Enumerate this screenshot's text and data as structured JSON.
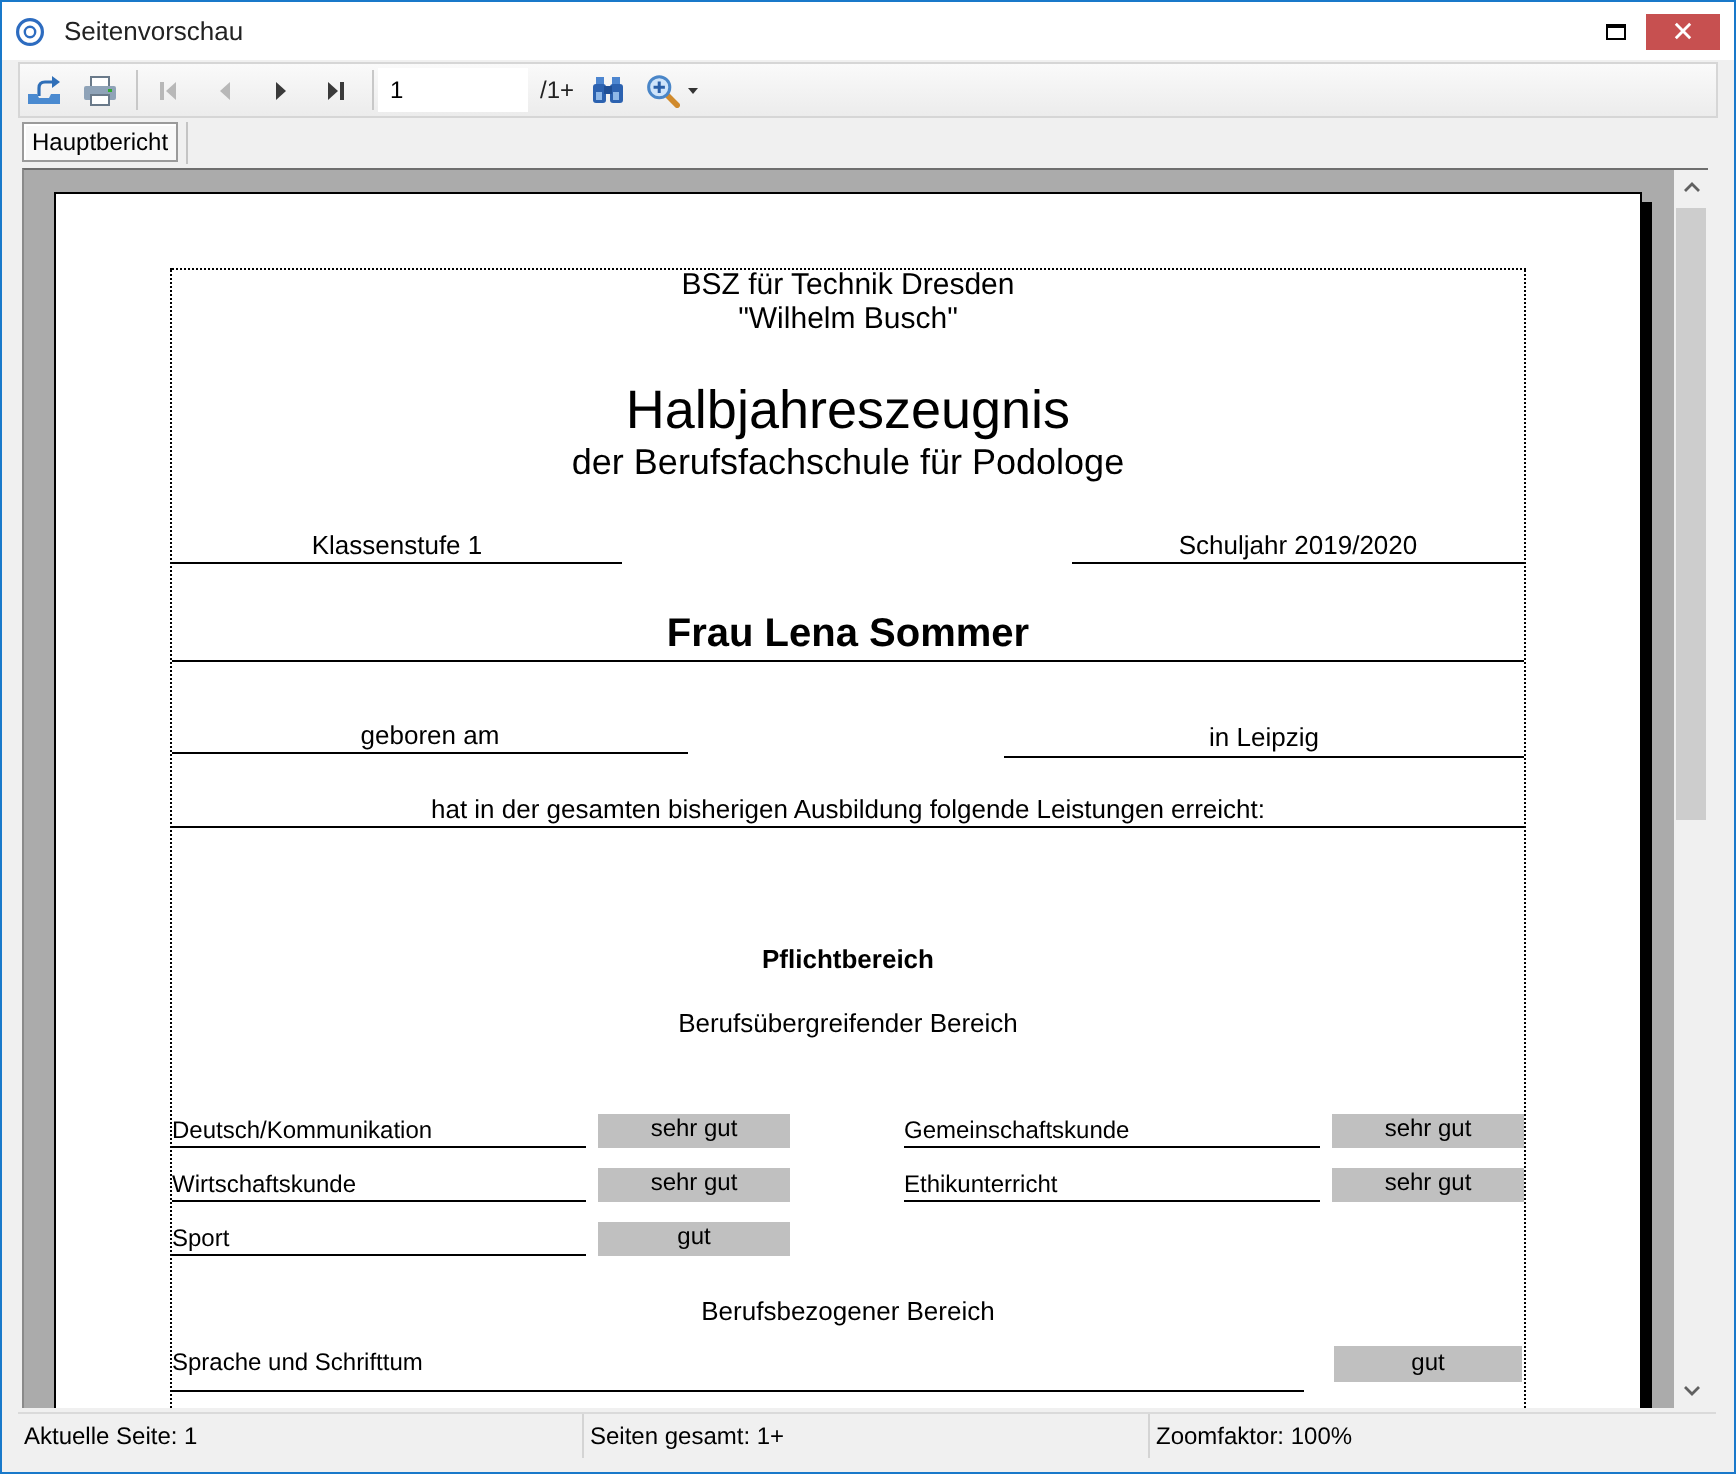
{
  "window": {
    "title": "Seitenvorschau"
  },
  "toolbar": {
    "nav_buttons": [
      {
        "kind": "first",
        "disabled": true
      },
      {
        "kind": "prev",
        "disabled": true
      },
      {
        "kind": "next",
        "disabled": false
      },
      {
        "kind": "last",
        "disabled": false
      }
    ],
    "page_field": {
      "value": "1"
    },
    "page_total": "/1+"
  },
  "tabs": [
    {
      "label": "Hauptbericht",
      "selected": true
    }
  ],
  "report": {
    "school": "BSZ für Technik Dresden",
    "school_name": "\"Wilhelm Busch\"",
    "title": "Halbjahreszeugnis",
    "subtitle": "der Berufsfachschule für Podologe",
    "class_level": "Klassenstufe 1",
    "school_year": "Schuljahr 2019/2020",
    "student": "Frau Lena Sommer",
    "birth_label": "geboren am",
    "birth_place": "in Leipzig",
    "intro": "hat in der gesamten bisherigen Ausbildung folgende Leistungen erreicht:",
    "section_title": "Pflichtbereich",
    "groups": [
      {
        "title": "Berufsübergreifender Bereich",
        "kind": "grid",
        "subjects": [
          {
            "name": "Deutsch/Kommunikation",
            "grade": "sehr gut"
          },
          {
            "name": "Gemeinschaftskunde",
            "grade": "sehr gut"
          },
          {
            "name": "Wirtschaftskunde",
            "grade": "sehr gut"
          },
          {
            "name": "Ethikunterricht",
            "grade": "sehr gut"
          },
          {
            "name": "Sport",
            "grade": "gut"
          }
        ]
      },
      {
        "title": "Berufsbezogener Bereich",
        "kind": "single",
        "subjects": [
          {
            "name": "Sprache und Schrifttum",
            "grade": "gut"
          }
        ]
      }
    ]
  },
  "status_bar": [
    "Aktuelle Seite: 1",
    "Seiten gesamt: 1+",
    "Zoomfaktor: 100%"
  ]
}
